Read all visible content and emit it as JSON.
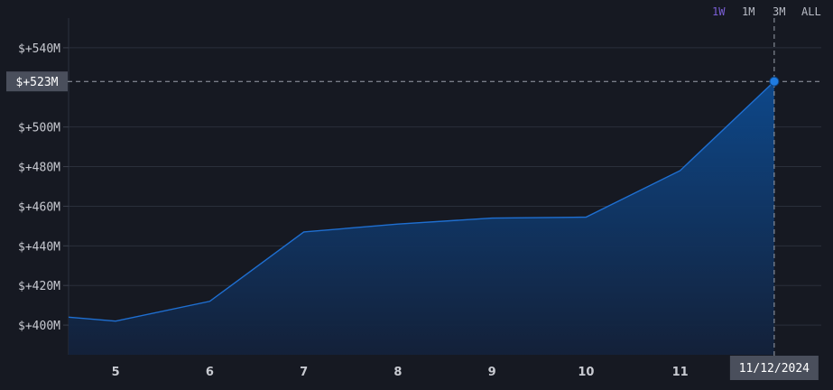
{
  "range_selector": {
    "options": [
      "1W",
      "1M",
      "3M",
      "ALL"
    ],
    "active": "1W"
  },
  "crosshair": {
    "y_label": "$+523M",
    "x_label": "11/12/2024"
  },
  "colors": {
    "background": "#161922",
    "line": "#1f6fd1",
    "area_top": "#0d4a8f",
    "area_bottom": "#13213a",
    "active_range": "#7b5fd6",
    "label_bg": "#4a4f5c"
  },
  "chart_data": {
    "type": "area",
    "x": [
      4.5,
      5,
      6,
      7,
      8,
      9,
      10,
      11,
      12
    ],
    "values": [
      404,
      402,
      412,
      447,
      451,
      454,
      454.5,
      478,
      523
    ],
    "x_ticks": [
      5,
      6,
      7,
      8,
      9,
      10,
      11
    ],
    "y_ticks": [
      400,
      420,
      440,
      460,
      480,
      500,
      540
    ],
    "y_tick_labels": [
      "$+400M",
      "$+420M",
      "$+440M",
      "$+460M",
      "$+480M",
      "$+500M",
      "$+540M"
    ],
    "xlim": [
      4.5,
      12.5
    ],
    "ylim": [
      385,
      555
    ],
    "grid": true,
    "title": "",
    "xlabel": "",
    "ylabel": ""
  }
}
